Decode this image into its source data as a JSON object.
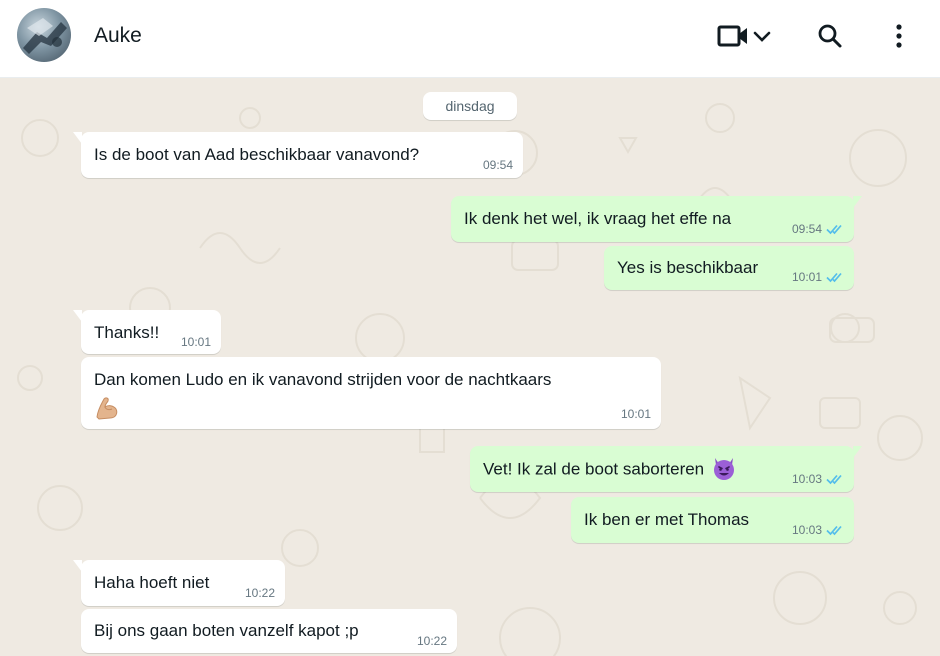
{
  "header": {
    "contact_name": "Auke",
    "icons": {
      "avatar": "contact-photo",
      "video_call": "video-camera-icon",
      "dropdown": "chevron-down-icon",
      "search": "search-icon",
      "menu": "more-vertical-icon"
    }
  },
  "chat": {
    "date_label": "dinsdag",
    "messages": [
      {
        "direction": "in",
        "text": "Is de boot van Aad beschikbaar vanavond?",
        "time": "09:54"
      },
      {
        "direction": "out",
        "text": "Ik denk het wel, ik vraag het effe na",
        "time": "09:54",
        "status": "read"
      },
      {
        "direction": "out",
        "text": "Yes is beschikbaar",
        "time": "10:01",
        "status": "read"
      },
      {
        "direction": "in",
        "text": "Thanks!!",
        "time": "10:01"
      },
      {
        "direction": "in",
        "text": "Dan komen Ludo en ik vanavond strijden voor de nachtkaars",
        "emoji": "flexed-biceps",
        "time": "10:01"
      },
      {
        "direction": "out",
        "text": "Vet! Ik zal de boot saborteren",
        "emoji": "smiling-face-with-horns",
        "time": "10:03",
        "status": "read"
      },
      {
        "direction": "out",
        "text": "Ik ben er met Thomas",
        "time": "10:03",
        "status": "read"
      },
      {
        "direction": "in",
        "text": "Haha hoeft niet",
        "time": "10:22"
      },
      {
        "direction": "in",
        "text": "Bij ons gaan boten vanzelf kapot ;p",
        "time": "10:22"
      }
    ]
  },
  "colors": {
    "header_bg": "#ffffff",
    "chat_bg": "#efeae2",
    "incoming_bubble": "#ffffff",
    "outgoing_bubble": "#d9fdd3",
    "read_ticks": "#53bdeb",
    "meta_text": "#667781"
  }
}
